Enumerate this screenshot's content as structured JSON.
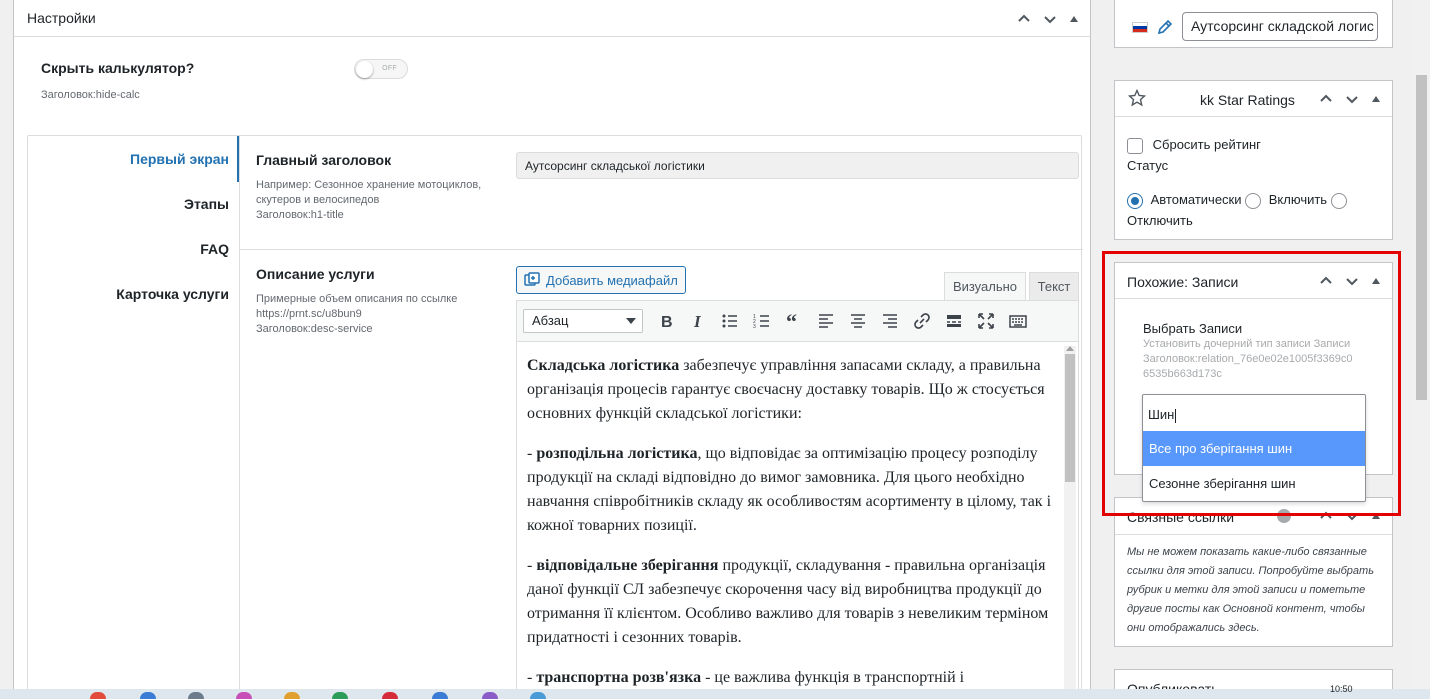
{
  "settings": {
    "title": "Настройки",
    "hide_calc_label": "Скрыть калькулятор?",
    "hide_calc_hint": "Заголовок:hide-calc",
    "toggle_text": "OFF"
  },
  "tabs": [
    {
      "label": "Первый экран",
      "active": true
    },
    {
      "label": "Этапы",
      "active": false
    },
    {
      "label": "FAQ",
      "active": false
    },
    {
      "label": "Карточка услуги",
      "active": false
    }
  ],
  "fields": {
    "h1": {
      "label": "Главный заголовок",
      "desc_example": "Например: Сезонное хранение мотоциклов, скутеров и велосипедов",
      "desc_key": "Заголовок:h1-title",
      "value": "Аутсорсинг складської логістики"
    },
    "desc_service": {
      "label": "Описание услуги",
      "desc_1": "Примерные объем описания по ссылке",
      "desc_2": "https://prnt.sc/u8bun9",
      "desc_3": "Заголовок:desc-service"
    }
  },
  "editor": {
    "add_media": "Добавить медиафайл",
    "tab_visual": "Визуально",
    "tab_text": "Текст",
    "format": "Абзац",
    "paragraphs": [
      {
        "bold": "Складська логістика",
        "text": " забезпечує управління запасами складу, а правильна організація процесів гарантує своєчасну доставку товарів. Що ж стосується основних функцій складської логістики:"
      },
      {
        "prefix": "- ",
        "bold": "розподільна логістика",
        "text": ", що відповідає за оптимізацію процесу розподілу продукції на складі відповідно до вимог замовника. Для цього необхідно навчання співробітників складу як особливостям асортименту в цілому, так і кожної товарних позиції."
      },
      {
        "prefix": "- ",
        "bold": "відповідальне зберігання",
        "text": " продукції, складування - правильна організація даної функції СЛ забезпечує скорочення часу від виробництва продукції до отримання її клієнтом. Особливо важливо для товарів з невеликим терміном придатності і сезонних товарів."
      },
      {
        "prefix": "- ",
        "bold": "транспортна розв'язка",
        "text": " - це важлива функція в транспортній і"
      }
    ]
  },
  "sidebar": {
    "lang_input": "Аутсорсинг складской логис",
    "kk": {
      "title": "kk Star Ratings",
      "reset": "Сбросить рейтинг",
      "status": "Статус",
      "auto": "Автоматически",
      "enable": "Включить",
      "disable": "Отключить"
    },
    "similar": {
      "title": "Похожие: Записи",
      "select_label": "Выбрать Записи",
      "hint_1": "Установить дочерний тип записи Записи",
      "hint_2": "Заголовок:relation_76e0e02e1005f3369c0",
      "hint_3": "6535b663d173c",
      "search_value": "Шин",
      "options": [
        "Все про зберігання шин",
        "Сезонне зберігання шин"
      ]
    },
    "related": {
      "title": "Связные ссылки",
      "text": "Мы не можем показать какие-либо связанные ссылки для этой записи. Попробуйте выбрать рубрик и метки для этой записи и пометьте другие посты как Основной контент, чтобы они отображались здесь."
    },
    "publish": {
      "title": "Опубликовать"
    }
  },
  "taskbar": {
    "time": "10:50"
  },
  "colors": {
    "accent": "#2271b1",
    "highlight": "#e30000",
    "select": "#5897fb"
  }
}
